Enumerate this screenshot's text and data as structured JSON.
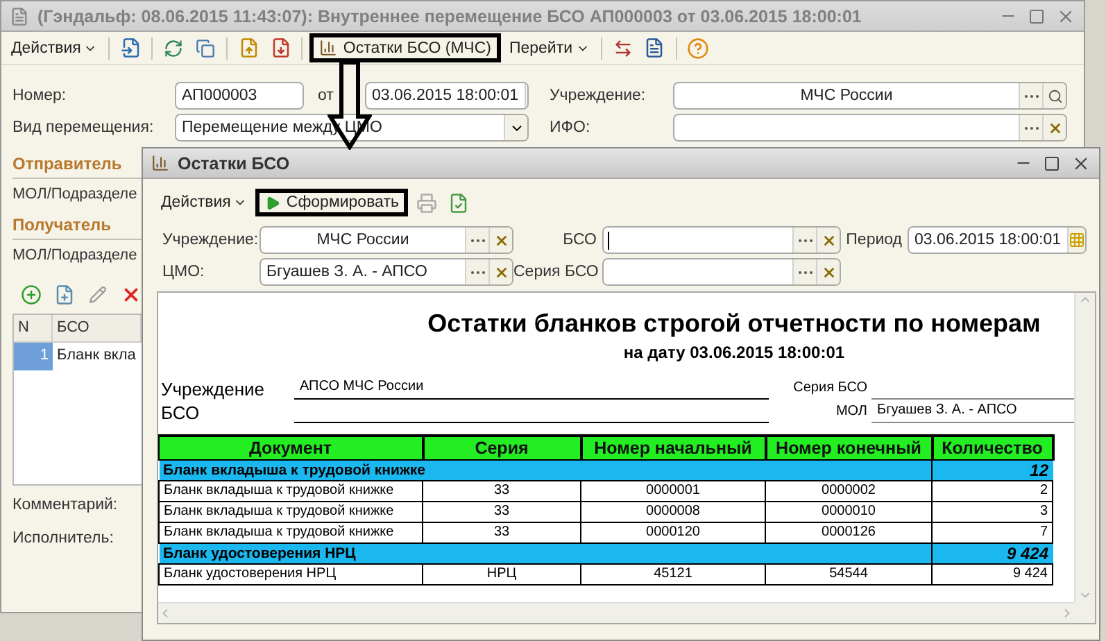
{
  "main_window": {
    "title": "(Гэндальф: 08.06.2015 11:43:07): Внутреннее перемещение БСО АП000003 от 03.06.2015 18:00:01",
    "toolbar": {
      "actions_menu": "Действия",
      "report_button": {
        "label": "Остатки БСО (МЧС)",
        "highlighted": true
      },
      "goto_menu": "Перейти"
    },
    "fields": {
      "number": {
        "label": "Номер:",
        "value": "АП000003"
      },
      "date": {
        "label": "от",
        "value": "03.06.2015 18:00:01"
      },
      "transfer_type": {
        "label": "Вид перемещения:",
        "value": "Перемещение между ЦМО"
      },
      "institution": {
        "label": "Учреждение:",
        "value": "МЧС России"
      },
      "ifo": {
        "label": "ИФО:"
      }
    },
    "sections": [
      {
        "title": "Отправитель",
        "field_label": "МОЛ/Подразделе"
      },
      {
        "title": "Получатель",
        "field_label": "МОЛ/Подразделе"
      }
    ],
    "table": {
      "columns": [
        "N",
        "БСО"
      ],
      "rows": [
        {
          "cells": [
            "1",
            "Бланк вкла"
          ],
          "selected": true
        }
      ]
    },
    "footer_fields": [
      "Комментарий:",
      "Исполнитель:"
    ]
  },
  "dialog": {
    "title": "Остатки БСО",
    "toolbar": {
      "actions_menu": "Действия",
      "generate_button": {
        "label": "Сформировать",
        "highlighted": true
      }
    },
    "fields": {
      "institution": {
        "label": "Учреждение:",
        "value": "МЧС России"
      },
      "bso": {
        "label": "БСО"
      },
      "period": {
        "label": "Период",
        "value": "03.06.2015 18:00:01"
      },
      "cmo": {
        "label": "ЦМО:",
        "value": "Бгуашев З. А. - АПСО"
      },
      "series": {
        "label": "Серия БСО"
      }
    },
    "report": {
      "title": "Остатки бланков строгой отчетности по номерам",
      "subtitle": "на дату 03.06.2015 18:00:01",
      "info_left": [
        {
          "label": "Учреждение",
          "value": "АПСО МЧС России"
        },
        {
          "label": "БСО"
        }
      ],
      "info_right": [
        {
          "label": "Серия БСО"
        },
        {
          "label": "МОЛ",
          "value": "Бгуашев З. А. - АПСО"
        }
      ],
      "table": {
        "columns": [
          "Документ",
          "Серия",
          "Номер начальный",
          "Номер конечный",
          "Количество"
        ],
        "rows": [
          {
            "kind": "group",
            "name": "Бланк вкладыша к трудовой книжке",
            "quantity": "12"
          },
          {
            "kind": "item",
            "cells": [
              "Бланк вкладыша к трудовой книжке",
              "33",
              "0000001",
              "0000002",
              "2"
            ]
          },
          {
            "kind": "item",
            "cells": [
              "Бланк вкладыша к трудовой книжке",
              "33",
              "0000008",
              "0000010",
              "3"
            ]
          },
          {
            "kind": "item",
            "cells": [
              "Бланк вкладыша к трудовой книжке",
              "33",
              "0000120",
              "0000126",
              "7"
            ]
          },
          {
            "kind": "group",
            "name": "Бланк удостоверения НРЦ",
            "quantity": "9 424"
          },
          {
            "kind": "item",
            "cells": [
              "Бланк удостоверения НРЦ",
              "НРЦ",
              "45121",
              "54544",
              "9 424"
            ]
          }
        ]
      }
    }
  }
}
